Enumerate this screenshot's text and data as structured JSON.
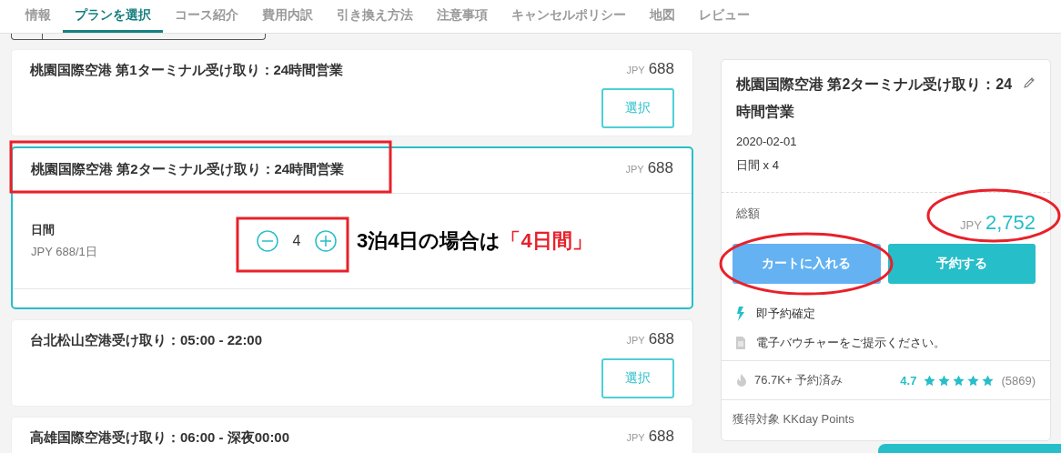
{
  "nav": {
    "tabs": [
      {
        "label": "情報",
        "selected": false
      },
      {
        "label": "プランを選択",
        "selected": true
      },
      {
        "label": "コース紹介",
        "selected": false
      },
      {
        "label": "費用内訳",
        "selected": false
      },
      {
        "label": "引き換え方法",
        "selected": false
      },
      {
        "label": "注意事項",
        "selected": false
      },
      {
        "label": "キャンセルポリシー",
        "selected": false
      },
      {
        "label": "地図",
        "selected": false
      },
      {
        "label": "レビュー",
        "selected": false
      }
    ]
  },
  "plans": [
    {
      "title": "桃園国際空港 第1ターミナル受け取り：24時間営業",
      "currency": "JPY",
      "price": "688",
      "button": "選択",
      "selected": false
    },
    {
      "title": "桃園国際空港 第2ターミナル受け取り：24時間営業",
      "currency": "JPY",
      "price": "688",
      "selected": true,
      "unit_label": "日間",
      "unit_price": "JPY 688/1日",
      "quantity": "4"
    },
    {
      "title": "台北松山空港受け取り：05:00 - 22:00",
      "currency": "JPY",
      "price": "688",
      "button": "選択",
      "selected": false
    },
    {
      "title": "高雄国際空港受け取り：06:00 - 深夜00:00",
      "currency": "JPY",
      "price": "688",
      "selected": false
    }
  ],
  "annotation": {
    "text": "3泊4日の場合は",
    "highlight": "「4日間」"
  },
  "summary": {
    "title": "桃園国際空港 第2ターミナル受け取り：24時間営業",
    "date": "2020-02-01",
    "quantity": "日間 x 4",
    "total_label": "総額",
    "currency": "JPY",
    "total": "2,752",
    "cart_button": "カートに入れる",
    "book_button": "予約する",
    "features": [
      {
        "kind": "instant",
        "text": "即予約確定"
      },
      {
        "kind": "voucher",
        "text": "電子バウチャーをご提示ください。"
      }
    ],
    "booked": "76.7K+ 予約済み",
    "rating": "4.7",
    "stars": 5,
    "reviews": "(5869)",
    "points": "獲得対象 KKday Points"
  }
}
